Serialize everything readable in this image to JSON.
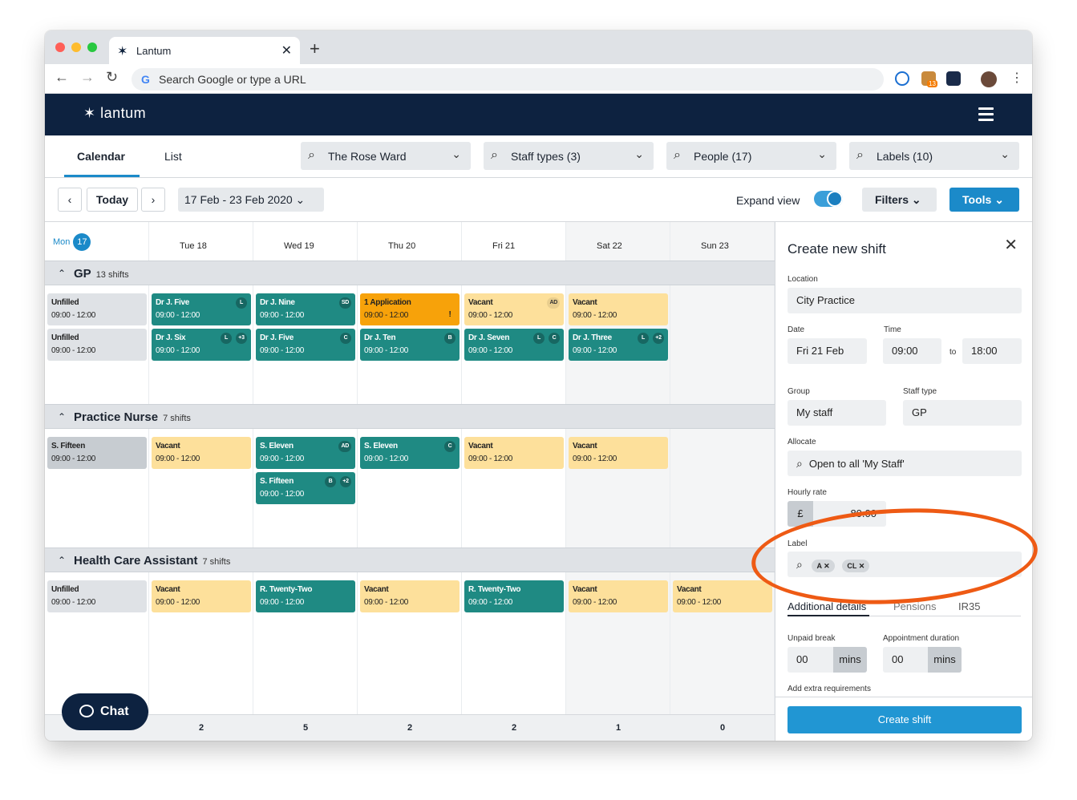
{
  "browser": {
    "tab_title": "Lantum",
    "url_placeholder": "Search Google or type a URL",
    "ext_badge": "13"
  },
  "app": {
    "logo": "lantum",
    "view_tabs": [
      {
        "label": "Calendar",
        "active": true
      },
      {
        "label": "List",
        "active": false
      }
    ],
    "filters": {
      "ward": "The Rose Ward",
      "staff_types": "Staff types (3)",
      "people": "People (17)",
      "labels": "Labels (10)"
    },
    "toolbar": {
      "today": "Today",
      "date_range": "17 Feb - 23 Feb 2020",
      "expand_view": "Expand view",
      "expand_on": true,
      "filters_btn": "Filters",
      "tools_btn": "Tools"
    }
  },
  "calendar": {
    "days": [
      {
        "label": "Mon",
        "num": "17",
        "today": true
      },
      {
        "label": "Tue 18"
      },
      {
        "label": "Wed 19"
      },
      {
        "label": "Thu 20"
      },
      {
        "label": "Fri 21"
      },
      {
        "label": "Sat 22",
        "weekend": true
      },
      {
        "label": "Sun 23",
        "weekend": true
      }
    ],
    "groups": [
      {
        "name": "GP",
        "count": "13 shifts",
        "rows": [
          [
            {
              "title": "Unfilled",
              "time": "09:00 - 12:00",
              "kind": "unfilled"
            },
            {
              "title": "Dr J. Five",
              "time": "09:00 - 12:00",
              "kind": "teal",
              "tags": [
                "L"
              ]
            },
            {
              "title": "Dr J. Nine",
              "time": "09:00 - 12:00",
              "kind": "teal",
              "tags": [
                "SD"
              ]
            },
            {
              "title": "1 Application",
              "time": "09:00 - 12:00",
              "kind": "orange",
              "tags": [
                "!"
              ]
            },
            {
              "title": "Vacant",
              "time": "09:00 - 12:00",
              "kind": "vacant",
              "tags": [
                "AD"
              ]
            },
            {
              "title": "Vacant",
              "time": "09:00 - 12:00",
              "kind": "vacant"
            }
          ],
          [
            {
              "title": "Unfilled",
              "time": "09:00 - 12:00",
              "kind": "unfilled"
            },
            {
              "title": "Dr J. Six",
              "time": "09:00 - 12:00",
              "kind": "teal",
              "tags": [
                "L",
                "+3"
              ]
            },
            {
              "title": "Dr J. Five",
              "time": "09:00 - 12:00",
              "kind": "teal",
              "tags": [
                "C"
              ]
            },
            {
              "title": "Dr J. Ten",
              "time": "09:00 - 12:00",
              "kind": "teal",
              "tags": [
                "B"
              ]
            },
            {
              "title": "Dr J. Seven",
              "time": "09:00 - 12:00",
              "kind": "teal",
              "tags": [
                "L",
                "C"
              ]
            },
            {
              "title": "Dr J. Three",
              "time": "09:00 - 12:00",
              "kind": "teal",
              "tags": [
                "L",
                "+2"
              ]
            }
          ]
        ]
      },
      {
        "name": "Practice Nurse",
        "count": "7 shifts",
        "rows": [
          [
            {
              "title": "S. Fifteen",
              "time": "09:00 - 12:00",
              "kind": "grey"
            },
            {
              "title": "Vacant",
              "time": "09:00 - 12:00",
              "kind": "vacant"
            },
            {
              "title": "S. Eleven",
              "time": "09:00 - 12:00",
              "kind": "teal",
              "tags": [
                "AD"
              ]
            },
            {
              "title": "S. Eleven",
              "time": "09:00 - 12:00",
              "kind": "teal",
              "tags": [
                "C"
              ]
            },
            {
              "title": "Vacant",
              "time": "09:00 - 12:00",
              "kind": "vacant"
            },
            {
              "title": "Vacant",
              "time": "09:00 - 12:00",
              "kind": "vacant"
            }
          ],
          [
            null,
            null,
            {
              "title": "S. Fifteen",
              "time": "09:00 - 12:00",
              "kind": "teal",
              "tags": [
                "B",
                "+2"
              ]
            }
          ]
        ]
      },
      {
        "name": "Health Care Assistant",
        "count": "7 shifts",
        "rows": [
          [
            {
              "title": "Unfilled",
              "time": "09:00 - 12:00",
              "kind": "unfilled"
            },
            {
              "title": "Vacant",
              "time": "09:00 - 12:00",
              "kind": "vacant"
            },
            {
              "title": "R. Twenty-Two",
              "time": "09:00 - 12:00",
              "kind": "teal"
            },
            {
              "title": "Vacant",
              "time": "09:00 - 12:00",
              "kind": "vacant"
            },
            {
              "title": "R. Twenty-Two",
              "time": "09:00 - 12:00",
              "kind": "teal"
            },
            {
              "title": "Vacant",
              "time": "09:00 - 12:00",
              "kind": "vacant"
            },
            {
              "title": "Vacant",
              "time": "09:00 - 12:00",
              "kind": "vacant"
            }
          ]
        ]
      }
    ],
    "totals": [
      "",
      "2",
      "5",
      "2",
      "2",
      "1",
      "0"
    ]
  },
  "chat": {
    "label": "Chat"
  },
  "panel": {
    "title": "Create new shift",
    "location_label": "Location",
    "location": "City Practice",
    "date_label": "Date",
    "date": "Fri 21 Feb",
    "time_label": "Time",
    "time_from": "09:00",
    "time_to_sep": "to",
    "time_to": "18:00",
    "group_label": "Group",
    "group": "My staff",
    "staff_type_label": "Staff type",
    "staff_type": "GP",
    "allocate_label": "Allocate",
    "allocate": "Open to all 'My Staff'",
    "rate_label": "Hourly rate",
    "rate_currency": "£",
    "rate": "80.00",
    "label_label": "Label",
    "chips": [
      "A",
      "CL"
    ],
    "tabs": [
      "Additional details",
      "Pensions",
      "IR35"
    ],
    "break_label": "Unpaid break",
    "break_value": "00",
    "break_unit": "mins",
    "duration_label": "Appointment duration",
    "duration_value": "00",
    "duration_unit": "mins",
    "extra_label": "Add extra requirements",
    "create_btn": "Create shift"
  },
  "colors": {
    "navy": "#0d2240",
    "blue": "#1b8ac9",
    "teal": "#1f8a83",
    "vacant": "#fde09b",
    "orange": "#f7a20a",
    "annotation": "#ee5a14"
  }
}
